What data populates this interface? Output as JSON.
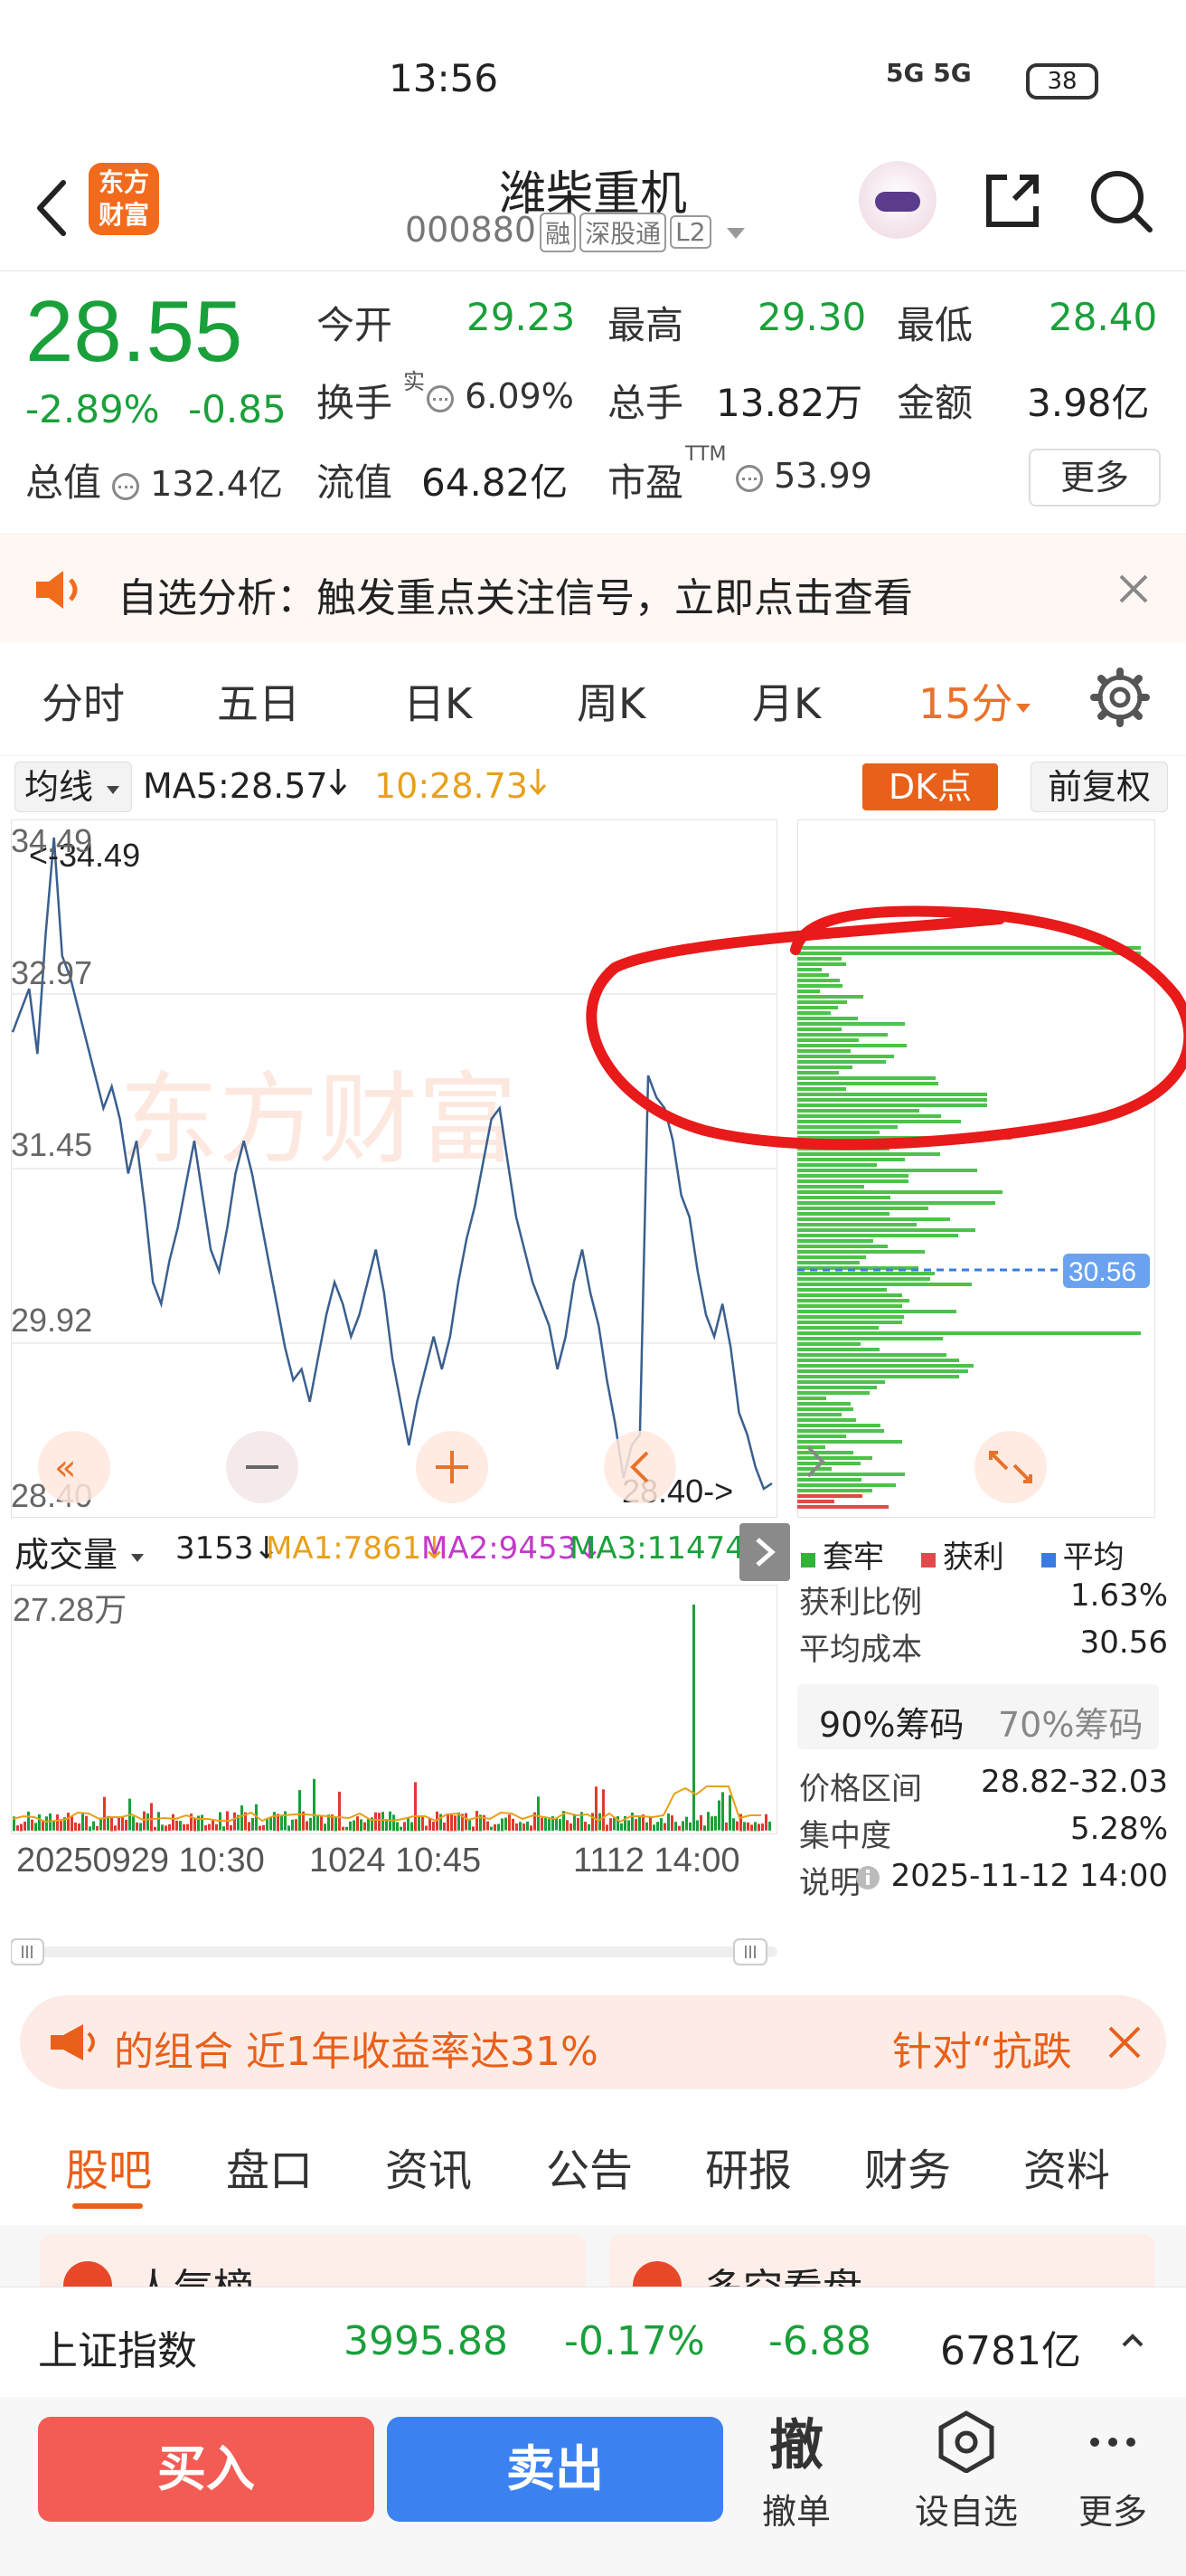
{
  "status": {
    "time": "13:56",
    "signal": "5G 5G",
    "battery": "38"
  },
  "header": {
    "logo_line1": "东方",
    "logo_line2": "财富",
    "name": "潍柴重机",
    "code": "000880",
    "tags": [
      "融",
      "深股通",
      "L2"
    ]
  },
  "quote": {
    "price": "28.55",
    "change_pct": "-2.89%",
    "change": "-0.85",
    "open_label": "今开",
    "open": "29.23",
    "high_label": "最高",
    "high": "29.30",
    "low_label": "最低",
    "low": "28.40",
    "turnover_label": "换手",
    "turnover_sup": "实",
    "turnover": "6.09%",
    "volume_label": "总手",
    "volume": "13.82万",
    "amount_label": "金额",
    "amount": "3.98亿",
    "mktcap_label": "总值",
    "mktcap": "132.4亿",
    "float_label": "流值",
    "float": "64.82亿",
    "pe_label": "市盈",
    "pe_sup": "TTM",
    "pe": "53.99",
    "more": "更多"
  },
  "banner": {
    "text": "自选分析：触发重点关注信号，立即点击查看"
  },
  "period_tabs": [
    "分时",
    "五日",
    "日K",
    "周K",
    "月K",
    "15分"
  ],
  "ma": {
    "select": "均线",
    "ma5": "MA5:28.57",
    "ma10": "10:28.73",
    "dk": "DK点",
    "adjust": "前复权"
  },
  "chart_data": {
    "type": "line",
    "y_ticks": [
      "34.49",
      "32.97",
      "31.45",
      "29.92",
      "28.40"
    ],
    "ylim": [
      28.4,
      34.49
    ],
    "max_label": "<-34.49",
    "min_label": "28.40->",
    "avg_cost_label": "30.56",
    "values": [
      32.7,
      32.9,
      33.1,
      32.5,
      33.6,
      34.49,
      33.4,
      33.2,
      32.9,
      32.6,
      32.3,
      32.0,
      32.2,
      31.9,
      31.4,
      31.7,
      31.1,
      30.4,
      30.2,
      30.6,
      30.9,
      31.3,
      31.7,
      31.2,
      30.7,
      30.5,
      30.9,
      31.4,
      31.7,
      31.4,
      31.0,
      30.6,
      30.2,
      29.8,
      29.5,
      29.6,
      29.3,
      29.7,
      30.1,
      30.4,
      30.2,
      29.9,
      30.1,
      30.4,
      30.7,
      30.3,
      29.7,
      29.3,
      28.9,
      29.3,
      29.6,
      29.9,
      29.6,
      29.9,
      30.4,
      30.8,
      31.1,
      31.5,
      31.9,
      32.0,
      31.5,
      31.0,
      30.7,
      30.4,
      30.2,
      30.0,
      29.6,
      29.9,
      30.4,
      30.7,
      30.3,
      30.0,
      29.5,
      29.1,
      28.6,
      28.9,
      29.0,
      32.3,
      32.1,
      32.0,
      31.7,
      31.2,
      31.0,
      30.5,
      30.1,
      29.9,
      30.2,
      29.8,
      29.2,
      29.0,
      28.7,
      28.5,
      28.55
    ]
  },
  "chips": {
    "legend": [
      {
        "label": "套牢",
        "color": "#2fb33a"
      },
      {
        "label": "获利",
        "color": "#e04a4a"
      },
      {
        "label": "平均",
        "color": "#3b7be0"
      }
    ],
    "profit_ratio_label": "获利比例",
    "profit_ratio": "1.63%",
    "avg_cost_label": "平均成本",
    "avg_cost": "30.56",
    "tab_90": "90%筹码",
    "tab_70": "70%筹码",
    "range_label": "价格区间",
    "range": "28.82-32.03",
    "concentration_label": "集中度",
    "concentration": "5.28%",
    "note_label": "说明",
    "note_time": "2025-11-12 14:00"
  },
  "volume": {
    "select": "成交量",
    "now": "3153↓",
    "ma1": "MA1:7861↓",
    "ma2": "MA2:9453↓",
    "ma3": "MA3:11474↓",
    "max_label": "27.28万"
  },
  "time_axis": [
    "20250929 10:30",
    "1024 10:45",
    "1112 14:00"
  ],
  "promo": {
    "text": "的组合 近1年收益率达31%",
    "right": "针对“抗跌"
  },
  "bottom_tabs": [
    "股吧",
    "盘口",
    "资讯",
    "公告",
    "研报",
    "财务",
    "资料"
  ],
  "peek": {
    "left": "人气榜",
    "right": "多空看盘"
  },
  "index_bar": {
    "name": "上证指数",
    "price": "3995.88",
    "pct": "-0.17%",
    "chg": "-6.88",
    "amount": "6781亿"
  },
  "actions": {
    "buy": "买入",
    "sell": "卖出",
    "cancel_icon": "撤",
    "cancel": "撤单",
    "watch": "设自选",
    "more": "更多"
  },
  "colors": {
    "up": "#e03a2f",
    "down": "#1aa03a",
    "accent": "#e8722a",
    "line": "#3a5f8f"
  }
}
